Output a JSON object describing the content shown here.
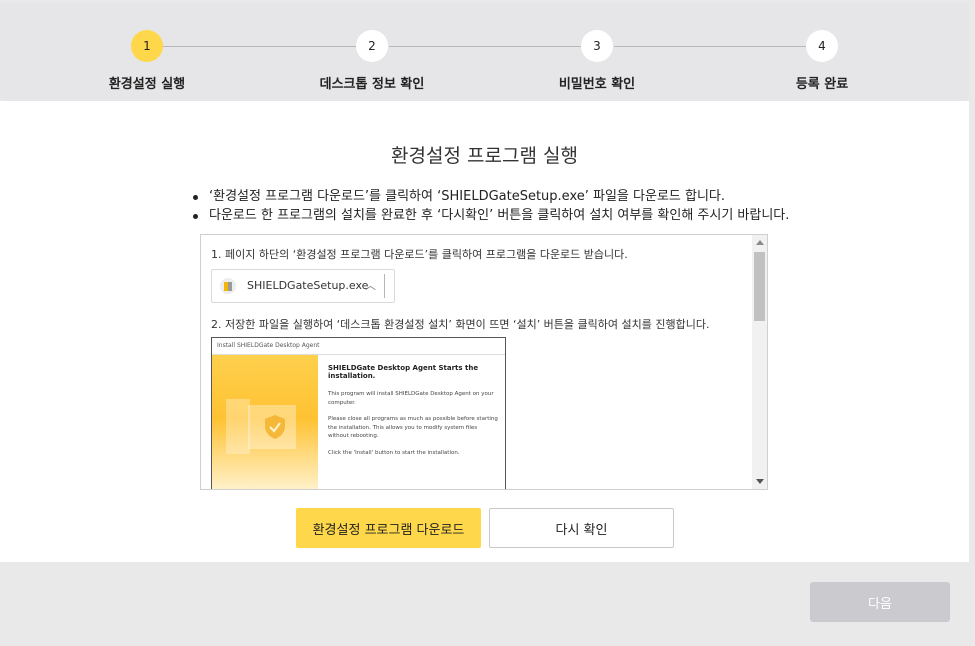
{
  "stepper": {
    "steps": [
      {
        "number": "1",
        "label": "환경설정 실행"
      },
      {
        "number": "2",
        "label": "데스크톱 정보 확인"
      },
      {
        "number": "3",
        "label": "비밀번호 확인"
      },
      {
        "number": "4",
        "label": "등록 완료"
      }
    ],
    "active_step": 1
  },
  "main": {
    "title": "환경설정 프로그램 실행",
    "bullets": [
      "‘환경설정 프로그램 다운로드’를 클릭하여 ‘SHIELDGateSetup.exe’ 파일을 다운로드 합니다.",
      "다운로드 한 프로그램의 설치를 완료한 후 ‘다시확인’ 버튼을 클릭하여 설치 여부를 확인해 주시기 바랍니다."
    ]
  },
  "guide": {
    "step1_text": "1. 페이지 하단의 ‘환경설정 프로그램 다운로드’를 클릭하여 프로그램을 다운로드 받습니다.",
    "download_filename": "SHIELDGateSetup.exe",
    "step2_text": "2. 저장한 파일을 실행하여 ‘데스크톱 환경설정 설치’ 화면이 뜨면 ‘설치’ 버튼을 클릭하여 설치를 진행합니다.",
    "installer": {
      "window_title": "Install SHIELDGate Desktop Agent",
      "heading": "SHIELDGate Desktop Agent Starts the installation.",
      "paragraphs": [
        "This program will install SHIELDGate Desktop Agent on your computer.",
        "Please close all programs as much as possible before starting the installation. This allows you to modify system files without rebooting.",
        "Click the 'Install' button to start the installation."
      ]
    }
  },
  "buttons": {
    "download": "환경설정 프로그램 다운로드",
    "recheck": "다시 확인",
    "next": "다음"
  },
  "colors": {
    "accent_yellow": "#fed84a",
    "disabled_gray": "#cbcbcf",
    "header_gray": "#e6e6e8"
  }
}
